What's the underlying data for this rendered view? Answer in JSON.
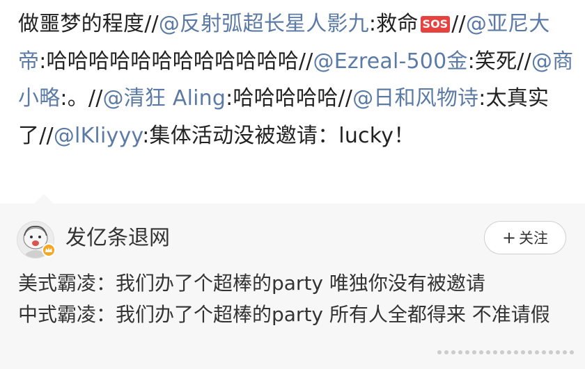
{
  "repost": {
    "seg1": "做噩梦的程度//",
    "m1": "@反射弧超长星人影九",
    "seg2": ":救命",
    "sos": "SOS",
    "seg3": "//",
    "m2": "@亚尼大帝",
    "seg4": ":哈哈哈哈哈哈哈哈哈哈哈哈//",
    "m3": "@Ezreal-500金",
    "seg5": ":笑死//",
    "m4": "@商小略",
    "seg6": ":。//",
    "m5": "@清狂 Aling",
    "seg7": ":哈哈哈哈哈//",
    "m6": "@日和风物诗",
    "seg8": ":太真实了//",
    "m7": "@lKliyyy",
    "seg9": ":集体活动没被邀请：lucky！"
  },
  "quoted": {
    "username": "发亿条退网",
    "follow_label": "关注",
    "follow_icon": "plus-icon",
    "line1": "美式霸凌：我们办了个超棒的party 唯独你没有被邀请",
    "line2": "中式霸凌：我们办了个超棒的party 所有人全都得来 不准请假"
  },
  "colors": {
    "mention": "#5b7ba6",
    "text": "#222222",
    "card_bg": "#f7f7f7",
    "sos_bg": "#e64340",
    "verified_badge": "#f5a623"
  }
}
